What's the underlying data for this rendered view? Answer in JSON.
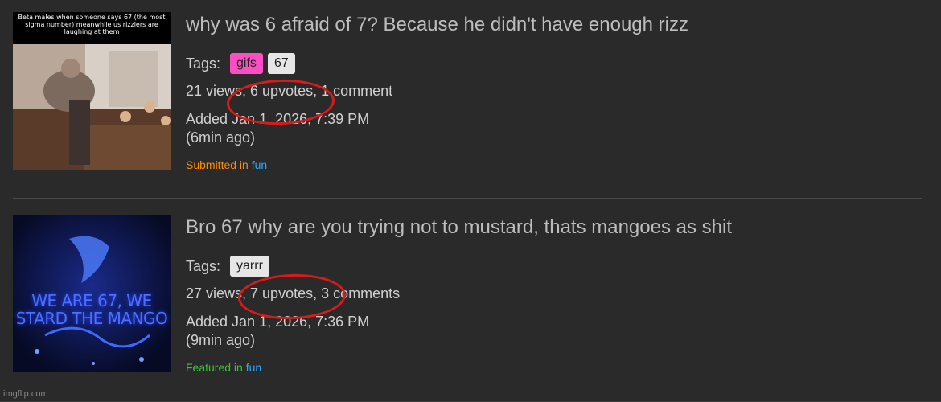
{
  "posts": [
    {
      "thumbnail_caption": "Beta males when someone says 67 (the most sigma number) meanwhile us rizzlers are laughing at them",
      "title": "why was 6 afraid of 7? Because he didn't have enough rizz",
      "tags_label": "Tags:",
      "tags": [
        {
          "label": "gifs",
          "color": "#ff4dc4"
        },
        {
          "label": "67",
          "color": "#e6e6e6"
        }
      ],
      "stats": "21 views, 6 upvotes, 1 comment",
      "added": "Added Jan 1, 2026, 7:39 PM",
      "ago": "(6min ago)",
      "status_text": "Submitted in ",
      "status_color": "#ff8a00",
      "stream": "fun"
    },
    {
      "thumbnail_caption": "WE ARE 67, WE STARD THE MANGO",
      "title": "Bro 67 why are you trying not to mustard, thats mangoes as shit",
      "tags_label": "Tags:",
      "tags": [
        {
          "label": "yarrr",
          "color": "#e6e6e6"
        }
      ],
      "stats": "27 views, 7 upvotes, 3 comments",
      "added": "Added Jan 1, 2026, 7:36 PM",
      "ago": "(9min ago)",
      "status_text": "Featured in ",
      "status_color": "#38c438",
      "stream": "fun"
    }
  ],
  "annotation_color": "#d61b1b",
  "watermark": "imgflip.com"
}
